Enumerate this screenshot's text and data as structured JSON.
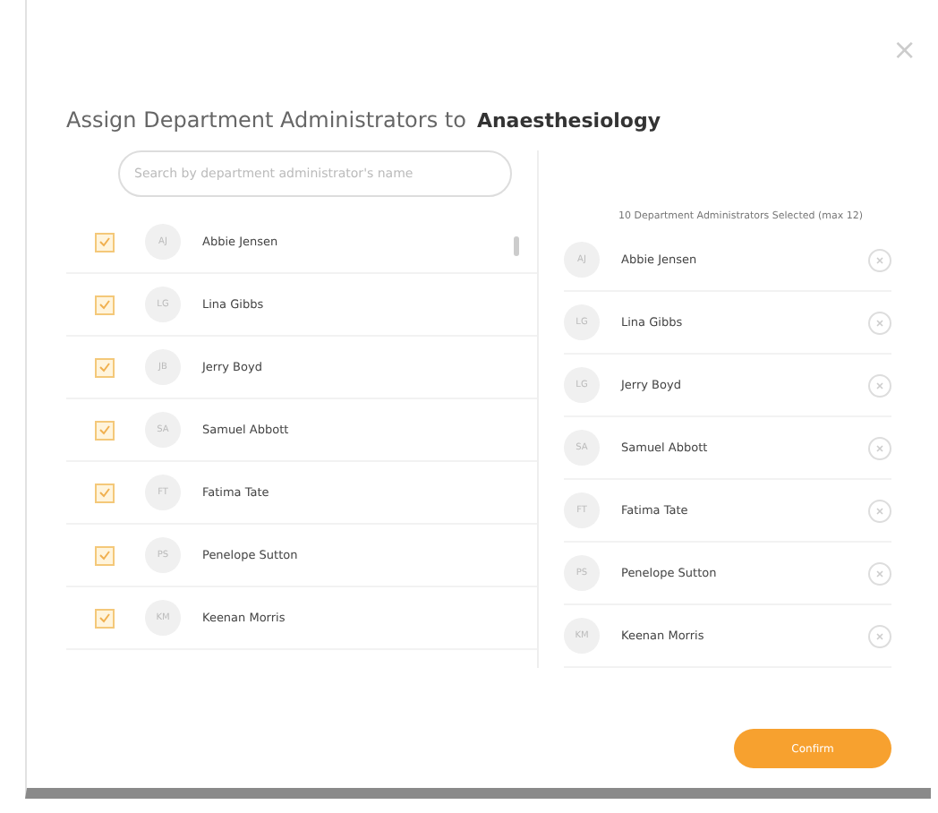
{
  "dialog": {
    "title": "Assign Department Administrators to",
    "department": "Anaesthesiology",
    "close": "×"
  },
  "search": {
    "placeholder": "Search by department administrator's name"
  },
  "available": [
    {
      "initials": "AJ",
      "name": "Abbie Jensen",
      "checked": true
    },
    {
      "initials": "LG",
      "name": "Lina Gibbs",
      "checked": true
    },
    {
      "initials": "JB",
      "name": "Jerry Boyd",
      "checked": true
    },
    {
      "initials": "SA",
      "name": "Samuel Abbott",
      "checked": true
    },
    {
      "initials": "FT",
      "name": "Fatima Tate",
      "checked": true
    },
    {
      "initials": "PS",
      "name": "Penelope Sutton",
      "checked": true
    },
    {
      "initials": "KM",
      "name": "Keenan Morris",
      "checked": true
    }
  ],
  "selected_header": "10 Department Administrators Selected (max 12)",
  "selected": [
    {
      "initials": "AJ",
      "name": "Abbie Jensen"
    },
    {
      "initials": "LG",
      "name": "Lina Gibbs"
    },
    {
      "initials": "LG",
      "name": "Jerry Boyd"
    },
    {
      "initials": "SA",
      "name": "Samuel Abbott"
    },
    {
      "initials": "FT",
      "name": "Fatima Tate"
    },
    {
      "initials": "PS",
      "name": "Penelope Sutton"
    },
    {
      "initials": "KM",
      "name": "Keenan Morris"
    }
  ],
  "confirm": "Confirm"
}
